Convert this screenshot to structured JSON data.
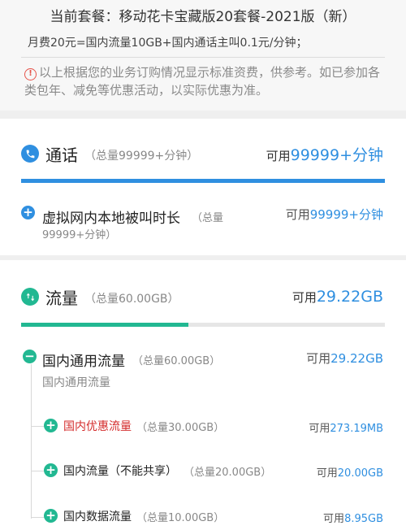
{
  "plan": {
    "title": "当前套餐：移动花卡宝藏版20套餐-2021版（新）",
    "description": "月费20元=国内流量10GB+国内通话主叫0.1元/分钟；",
    "notice": "以上根据您的业务订购情况显示标准资费，供参考。如已参加各类包年、减免等优惠活动，以实际优惠为准。"
  },
  "calls": {
    "title": "通话",
    "total": "（总量99999+分钟）",
    "available_label": "可用",
    "available_value": "99999+分钟",
    "usage_fraction": 1.0,
    "color": "#2f8fe0",
    "items": [
      {
        "name": "虚拟网内本地被叫时长",
        "total_line1": "（总量",
        "total_line2": "99999+分钟）",
        "available_label": "可用",
        "available_value": "99999+分钟"
      }
    ]
  },
  "data": {
    "title": "流量",
    "total": "（总量60.00GB）",
    "available_label": "可用",
    "available_value": "29.22GB",
    "usage_fraction": 0.46,
    "color": "#22b892",
    "group": {
      "name": "国内通用流量",
      "total": "（总量60.00GB）",
      "subtitle": "国内通用流量",
      "available_label": "可用",
      "available_value": "29.22GB"
    },
    "items": [
      {
        "name": "国内优惠流量",
        "total": "（总量30.00GB）",
        "available_label": "可用",
        "available_value": "273.19MB",
        "name_color": "#d42d2d"
      },
      {
        "name": "国内流量（不能共享）",
        "total": "（总量20.00GB）",
        "available_label": "可用",
        "available_value": "20.00GB",
        "name_color": "#222222"
      },
      {
        "name": "国内数据流量",
        "total": "（总量10.00GB）",
        "available_label": "可用",
        "available_value": "8.95GB",
        "name_color": "#222222"
      }
    ]
  },
  "icons": {
    "phone": "phone-icon",
    "data": "data-transfer-icon",
    "warning": "warning-icon",
    "expand": "plus-icon",
    "collapse": "minus-icon"
  }
}
